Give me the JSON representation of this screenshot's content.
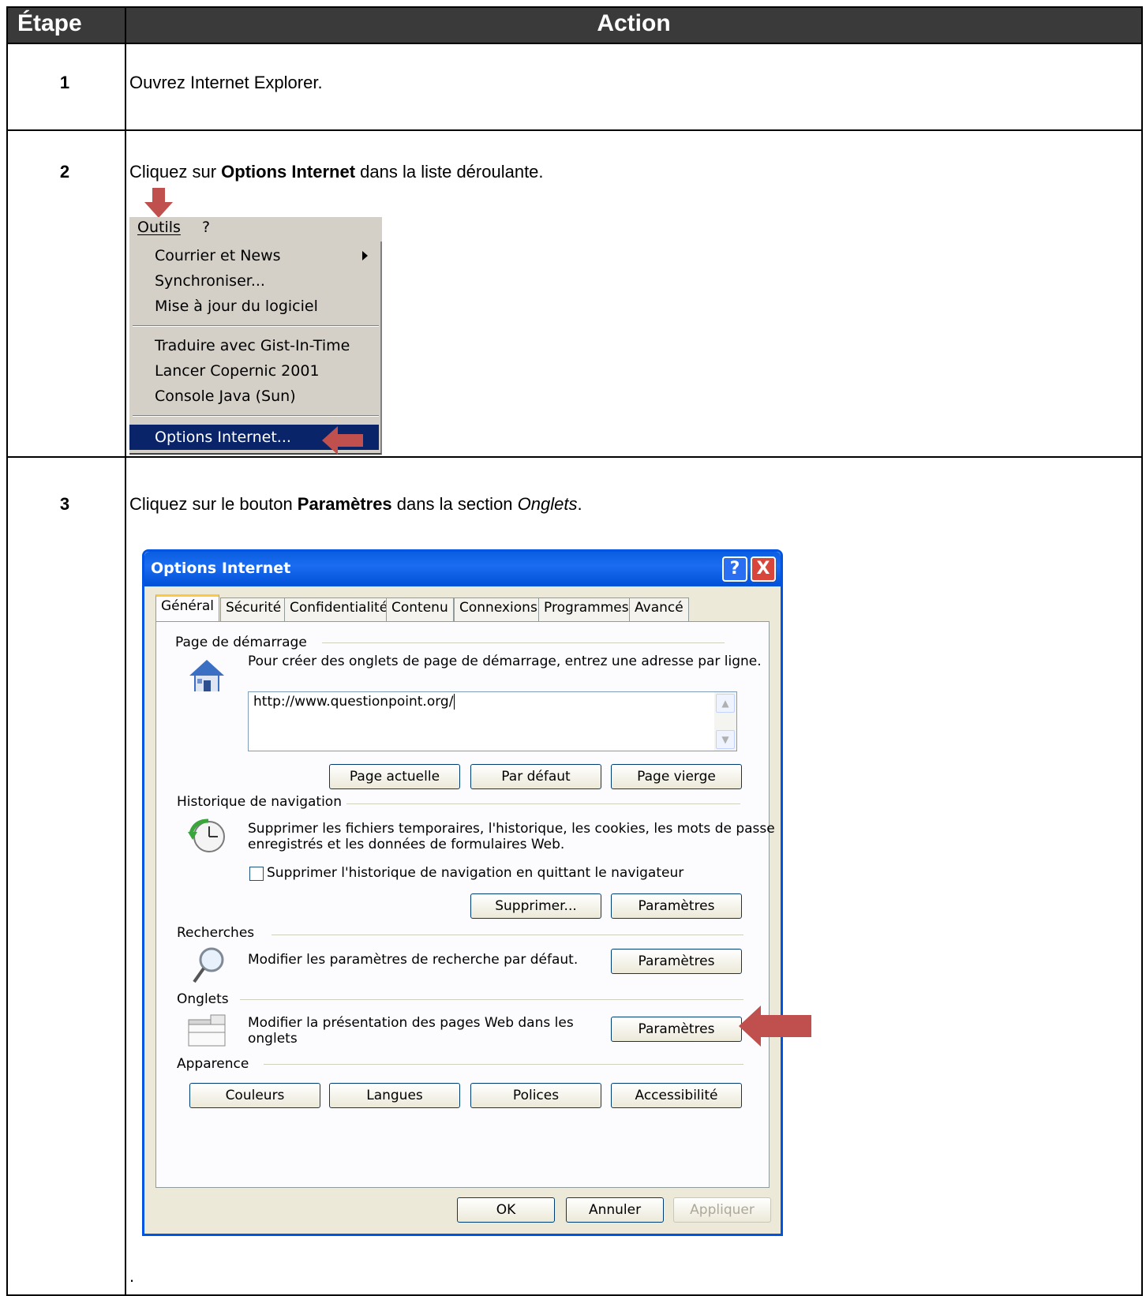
{
  "table": {
    "header_step": "Étape",
    "header_action": "Action"
  },
  "rows": [
    {
      "step": "1",
      "text": "Ouvrez Internet Explorer."
    },
    {
      "step": "2",
      "text_before": "Cliquez sur ",
      "text_bold": "Options Internet",
      "text_after": " dans la liste déroulante."
    },
    {
      "step": "3",
      "text_before": "Cliquez sur le bouton ",
      "text_bold": "Paramètres",
      "text_mid": " dans la section ",
      "text_italic": "Onglets",
      "text_after": "."
    }
  ],
  "trailing_dot": ".",
  "menu": {
    "bar_items": [
      "Outils",
      "?"
    ],
    "items": [
      {
        "label": "Courrier et News",
        "submenu": true
      },
      {
        "label": "Synchroniser..."
      },
      {
        "label": "Mise à jour du logiciel"
      },
      {
        "label": "Traduire avec Gist-In-Time"
      },
      {
        "label": "Lancer Copernic 2001"
      },
      {
        "label": "Console Java (Sun)"
      },
      {
        "label": "Options Internet...",
        "highlighted": true
      }
    ]
  },
  "dialog": {
    "title": "Options Internet",
    "help_btn": "?",
    "close_btn": "X",
    "tabs": [
      "Général",
      "Sécurité",
      "Confidentialité",
      "Contenu",
      "Connexions",
      "Programmes",
      "Avancé"
    ],
    "active_tab": "Général",
    "home": {
      "section": "Page de démarrage",
      "desc": "Pour créer des onglets de page de démarrage, entrez une adresse par ligne.",
      "url": "http://www.questionpoint.org/",
      "btn_current": "Page actuelle",
      "btn_default": "Par défaut",
      "btn_blank": "Page vierge"
    },
    "history": {
      "section": "Historique de navigation",
      "desc_line1": "Supprimer les fichiers temporaires, l'historique, les cookies, les mots de passe",
      "desc_line2": "enregistrés et les données de formulaires Web.",
      "checkbox_label": "Supprimer l'historique de navigation en quittant le navigateur",
      "btn_delete": "Supprimer...",
      "btn_settings": "Paramètres"
    },
    "search": {
      "section": "Recherches",
      "desc": "Modifier les paramètres de recherche par défaut.",
      "btn_settings": "Paramètres"
    },
    "tabs_section": {
      "section": "Onglets",
      "desc_line1": "Modifier la présentation des pages Web dans les",
      "desc_line2": "onglets",
      "btn_settings": "Paramètres"
    },
    "appearance": {
      "section": "Apparence",
      "btn_colors": "Couleurs",
      "btn_languages": "Langues",
      "btn_fonts": "Polices",
      "btn_accessibility": "Accessibilité"
    },
    "footer": {
      "ok": "OK",
      "cancel": "Annuler",
      "apply": "Appliquer"
    }
  },
  "colors": {
    "header_bg": "#3a3a3a",
    "arrow_red": "#c0504d",
    "menu_highlight": "#0a246a",
    "xp_title_blue": "#0054e3"
  }
}
